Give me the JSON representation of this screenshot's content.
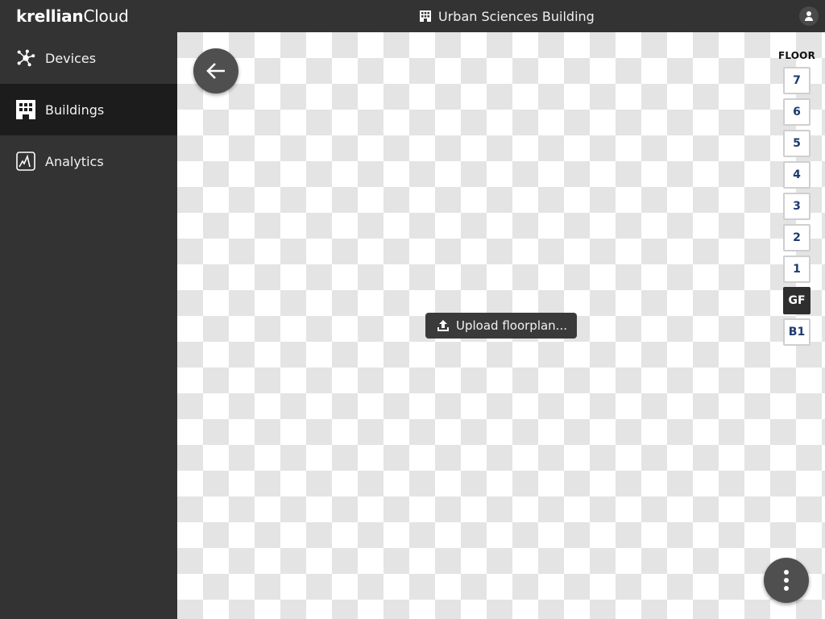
{
  "app": {
    "logo_bold": "krellian",
    "logo_light": "Cloud"
  },
  "header": {
    "building_icon": "building-icon",
    "title": "Urban Sciences Building",
    "user_icon": "user-account-icon"
  },
  "sidebar": {
    "items": [
      {
        "label": "Devices",
        "icon": "devices-network-icon",
        "active": false
      },
      {
        "label": "Buildings",
        "icon": "building-icon",
        "active": true
      },
      {
        "label": "Analytics",
        "icon": "analytics-chart-icon",
        "active": false
      }
    ]
  },
  "main": {
    "back_icon": "arrow-left-icon",
    "upload_label": "Upload floorplan...",
    "upload_icon": "upload-icon",
    "floor_header": "FLOOR",
    "floors": [
      "7",
      "6",
      "5",
      "4",
      "3",
      "2",
      "1",
      "GF",
      "B1"
    ],
    "selected_floor": "GF",
    "more_icon": "more-vertical-icon"
  },
  "colors": {
    "topbar": "#333333",
    "sidebar": "#333333",
    "sidebar_active": "#1c1c1c",
    "floor_text": "#1e3a6e",
    "floor_active": "#2e2e2e"
  }
}
